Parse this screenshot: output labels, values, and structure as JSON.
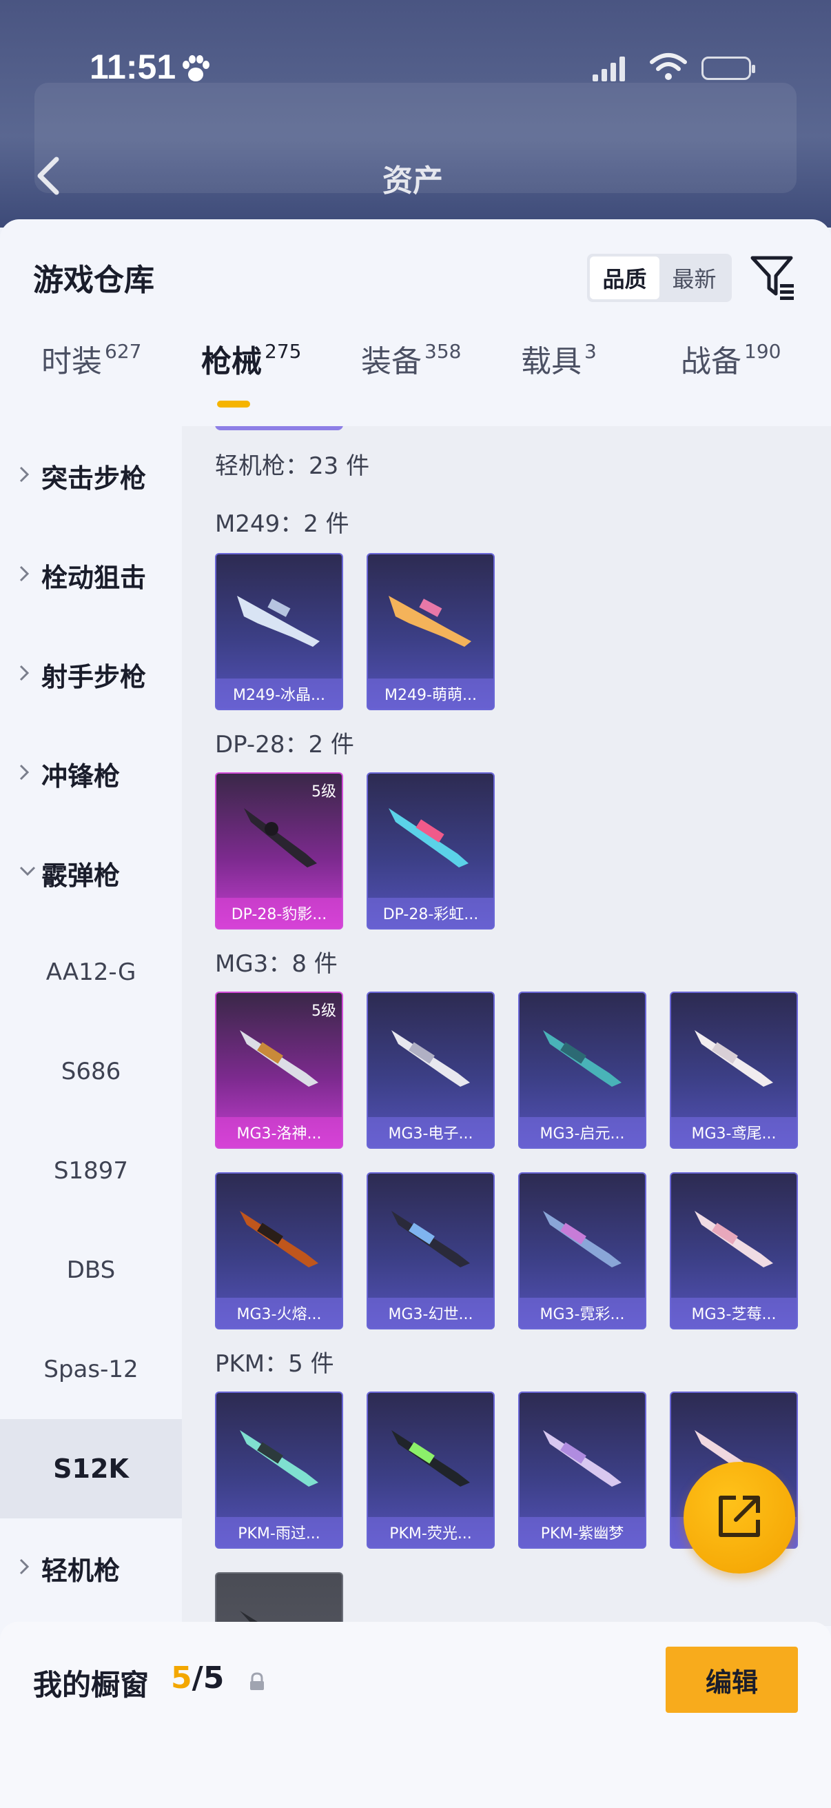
{
  "status_bar": {
    "time": "11:51"
  },
  "top_nav": {
    "title": "资产"
  },
  "sheet": {
    "title": "游戏仓库",
    "sort": {
      "options": [
        "品质",
        "最新"
      ],
      "active": "品质"
    }
  },
  "tabs": [
    {
      "label": "时装",
      "count": "627"
    },
    {
      "label": "枪械",
      "count": "275",
      "active": true
    },
    {
      "label": "装备",
      "count": "358"
    },
    {
      "label": "载具",
      "count": "3"
    },
    {
      "label": "战备",
      "count": "190"
    }
  ],
  "sidebar": {
    "categories": [
      "突击步枪",
      "栓动狙击",
      "射手步枪",
      "冲锋枪",
      "霰弹枪"
    ],
    "sub_items": [
      "AA12-G",
      "S686",
      "S1897",
      "DBS",
      "Spas-12",
      "S12K"
    ],
    "active_sub": "S12K",
    "last_category": "轻机枪"
  },
  "content": {
    "category_summary": "轻机枪：23 件",
    "groups": [
      {
        "title": "M249：2 件",
        "items": [
          {
            "name": "M249-冰晶...",
            "grade": ""
          },
          {
            "name": "M249-萌萌...",
            "grade": ""
          }
        ]
      },
      {
        "title": "DP-28：2 件",
        "items": [
          {
            "name": "DP-28-豹影...",
            "grade": "5级"
          },
          {
            "name": "DP-28-彩虹...",
            "grade": ""
          }
        ]
      },
      {
        "title": "MG3：8 件",
        "items": [
          {
            "name": "MG3-洛神...",
            "grade": "5级"
          },
          {
            "name": "MG3-电子...",
            "grade": ""
          },
          {
            "name": "MG3-启元...",
            "grade": ""
          },
          {
            "name": "MG3-鸢尾...",
            "grade": ""
          },
          {
            "name": "MG3-火熔...",
            "grade": ""
          },
          {
            "name": "MG3-幻世...",
            "grade": ""
          },
          {
            "name": "MG3-霓彩...",
            "grade": ""
          },
          {
            "name": "MG3-芝莓...",
            "grade": ""
          }
        ]
      },
      {
        "title": "PKM：5 件",
        "items": [
          {
            "name": "PKM-雨过...",
            "grade": ""
          },
          {
            "name": "PKM-荧光...",
            "grade": ""
          },
          {
            "name": "PKM-紫幽梦",
            "grade": ""
          },
          {
            "name": "",
            "grade": ""
          }
        ]
      }
    ]
  },
  "bottom": {
    "label": "我的橱窗",
    "count_current": "5",
    "count_total": "/5",
    "edit_label": "编辑"
  },
  "colors": {
    "accent": "#f5b400",
    "purple_card": "#3c3f86",
    "pink_card": "#7c2a8e"
  }
}
